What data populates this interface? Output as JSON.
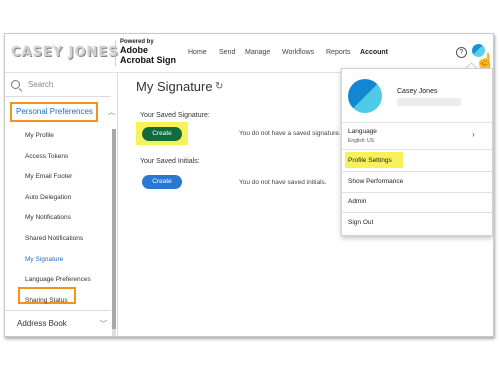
{
  "header": {
    "user_logo_text": "CASEY JONES",
    "powered_by": "Powered by",
    "product_line1": "Adobe",
    "product_line2": "Acrobat Sign",
    "nav": [
      "Home",
      "Send",
      "Manage",
      "Workflows",
      "Reports",
      "Account"
    ],
    "active_nav": "Account",
    "help_glyph": "?"
  },
  "sidebar": {
    "search_label": "Search",
    "section_label": "Personal Preferences",
    "items": [
      "My Profile",
      "Access Tokens",
      "My Email Footer",
      "Auto Delegation",
      "My Notifications",
      "Shared Notifications",
      "My Signature",
      "Language Preferences",
      "Sharing Status"
    ],
    "selected_item": "My Signature",
    "collapsed_section": "Address Book"
  },
  "main": {
    "title": "My Signature",
    "saved_signature_heading": "Your Saved Signature:",
    "saved_initials_heading": "Your Saved Initials:",
    "create_label": "Create",
    "no_signature_text": "You do not have a saved signature.",
    "no_initials_text": "You do not have saved initials."
  },
  "dropdown": {
    "user_name": "Casey Jones",
    "language_label": "Language",
    "language_value": "English: US",
    "items": [
      "Profile Settings",
      "Show Performance",
      "Admin",
      "Sign Out"
    ]
  },
  "icons": [
    "search-icon",
    "chevron-up-icon",
    "chevron-down-icon",
    "refresh-icon",
    "help-icon",
    "avatar-icon",
    "hand-cursor-icon",
    "chevron-right-icon"
  ],
  "colors": {
    "highlight_orange": "#f0941e",
    "highlight_yellow": "#f7f25a",
    "link_blue": "#1e6fc4",
    "create_green": "#136a3c",
    "create_blue": "#2b78d4"
  }
}
